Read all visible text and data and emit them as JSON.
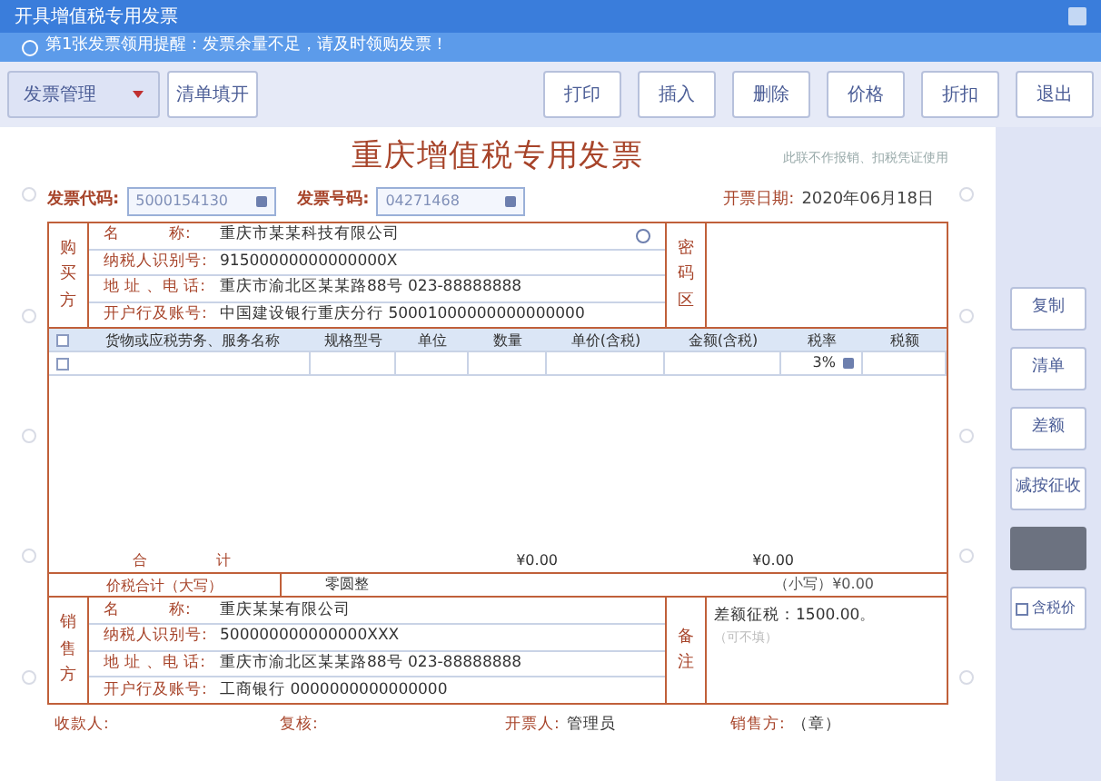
{
  "window": {
    "title": "开具增值税专用发票"
  },
  "notice": {
    "text": "第1张发票领用提醒：发票余量不足，请及时领购发票！"
  },
  "toolbar": {
    "dropdown": "发票管理",
    "left_button": "清单填开",
    "buttons": [
      "打印",
      "插入",
      "删除",
      "价格",
      "折扣",
      "退出"
    ]
  },
  "invoice": {
    "title": "重庆增值税专用发票",
    "subtitle": "此联不作报销、扣税凭证使用",
    "code_label": "发票代码:",
    "code": "5000154130",
    "number_label": "发票号码:",
    "number": "04271468",
    "date_label": "开票日期:",
    "date": "2020年06月18日",
    "buyer": {
      "side_label": "购买方",
      "fields": [
        {
          "label": "名　　　称:",
          "value": "重庆市某某科技有限公司",
          "lookup": true
        },
        {
          "label": "纳税人识别号:",
          "value": "91500000000000000X"
        },
        {
          "label": "地 址 、电 话:",
          "value": "重庆市渝北区某某路88号 023-88888888"
        },
        {
          "label": "开户行及账号:",
          "value": "中国建设银行重庆分行 50001000000000000000"
        }
      ],
      "cipher_label": "密码区"
    },
    "columns": [
      "货物或应税劳务、服务名称",
      "规格型号",
      "单位",
      "数量",
      "单价(含税)",
      "金额(含税)",
      "税率",
      "税额"
    ],
    "rows": [
      {
        "checked": false,
        "tax_rate": "3%"
      }
    ],
    "header_checked": false,
    "totals": {
      "label": "合",
      "label2": "计",
      "amount": "¥0.00",
      "tax": "¥0.00"
    },
    "grand_total": {
      "label": "价税合计（大写）",
      "words": "零圆整",
      "small": "（小写）¥0.00"
    },
    "seller": {
      "side_label": "销售方",
      "fields": [
        {
          "label": "名　　　称:",
          "value": "重庆某某有限公司"
        },
        {
          "label": "纳税人识别号:",
          "value": "500000000000000XXX"
        },
        {
          "label": "地 址 、电 话:",
          "value": "重庆市渝北区某某路88号 023-88888888"
        },
        {
          "label": "开户行及账号:",
          "value": "工商银行 0000000000000000"
        }
      ],
      "remark_label": "备注",
      "remark": "差额征税：1500.00。",
      "remark_hint": "（可不填）"
    },
    "footer": [
      {
        "label": "收款人:"
      },
      {
        "label": "复核:"
      },
      {
        "label": "开票人:",
        "value": "管理员"
      },
      {
        "label": "销售方:",
        "value": "（章）"
      }
    ]
  },
  "side_buttons": [
    {
      "kind": "button",
      "label": "复制"
    },
    {
      "kind": "button",
      "label": "清单"
    },
    {
      "kind": "button",
      "label": "差额"
    },
    {
      "kind": "button",
      "label": "减按征收"
    },
    {
      "kind": "blank"
    },
    {
      "kind": "check",
      "label": "含税价",
      "checked": false
    }
  ]
}
